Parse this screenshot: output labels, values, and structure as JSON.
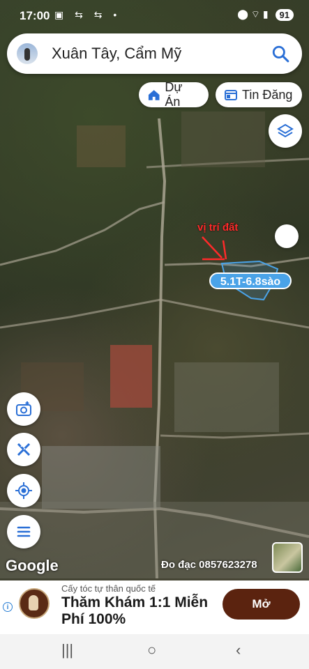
{
  "status_bar": {
    "time": "17:00",
    "left_icons": "▣ ⇆ ⇆ •",
    "right_icons": "⬤ ⌔ ▮",
    "battery": "91"
  },
  "search": {
    "title": "Xuân Tây, Cẩm Mỹ",
    "avatar_icon": "user-avatar",
    "search_icon": "search-icon"
  },
  "chips": {
    "du_an": "Dự Án",
    "tin_dang": "Tin Đăng"
  },
  "map": {
    "annotation_text": "vị trí đất",
    "price_label": "5.1T-6.8sào",
    "google_logo": "Google",
    "surveyor": "Đo đạc 0857623278"
  },
  "left_buttons": [
    "camera-add-icon",
    "ruler-pencil-icon",
    "my-location-icon",
    "menu-icon"
  ],
  "ad": {
    "sub": "Cấy tóc tự thân quốc tế",
    "headline": "Thăm Khám 1:1 Miễn Phí 100%",
    "cta": "Mở",
    "info_icon": "i"
  },
  "nav": {
    "recents": "|||",
    "home": "○",
    "back": "‹"
  },
  "colors": {
    "price_label_bg": "#4aa3e8",
    "annotation_red": "#ff2a2a",
    "cta_bg": "#5b230f",
    "search_blue": "#2a6fd6"
  }
}
